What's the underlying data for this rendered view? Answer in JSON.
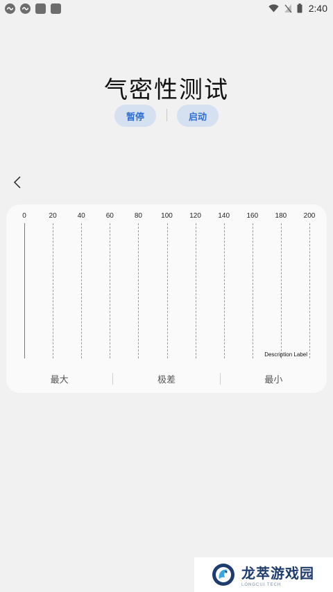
{
  "status_bar": {
    "time": "2:40",
    "notification_icons": [
      "app-notification-icon",
      "app-notification-icon",
      "app-square-icon",
      "app-square-icon"
    ],
    "right_icons": [
      "wifi-icon",
      "no-signal-icon",
      "battery-icon"
    ]
  },
  "page": {
    "title": "气密性测试",
    "pause_label": "暂停",
    "start_label": "启动"
  },
  "chart_data": {
    "type": "line",
    "x_ticks": [
      "0",
      "20",
      "40",
      "60",
      "80",
      "100",
      "120",
      "140",
      "160",
      "180",
      "200"
    ],
    "xlim": [
      0,
      200
    ],
    "grid": true,
    "series": [],
    "description_label": "Description Label"
  },
  "stats": {
    "max_label": "最大",
    "range_label": "极差",
    "min_label": "最小"
  },
  "watermark": {
    "title": "龙萃游戏园",
    "subtitle": "LONGCUI TECH"
  },
  "colors": {
    "background": "#f1f1f1",
    "card": "#fafafa",
    "pill_bg": "#d5e0f0",
    "pill_text": "#2f6fd3",
    "watermark_text": "#1e3c6e"
  }
}
